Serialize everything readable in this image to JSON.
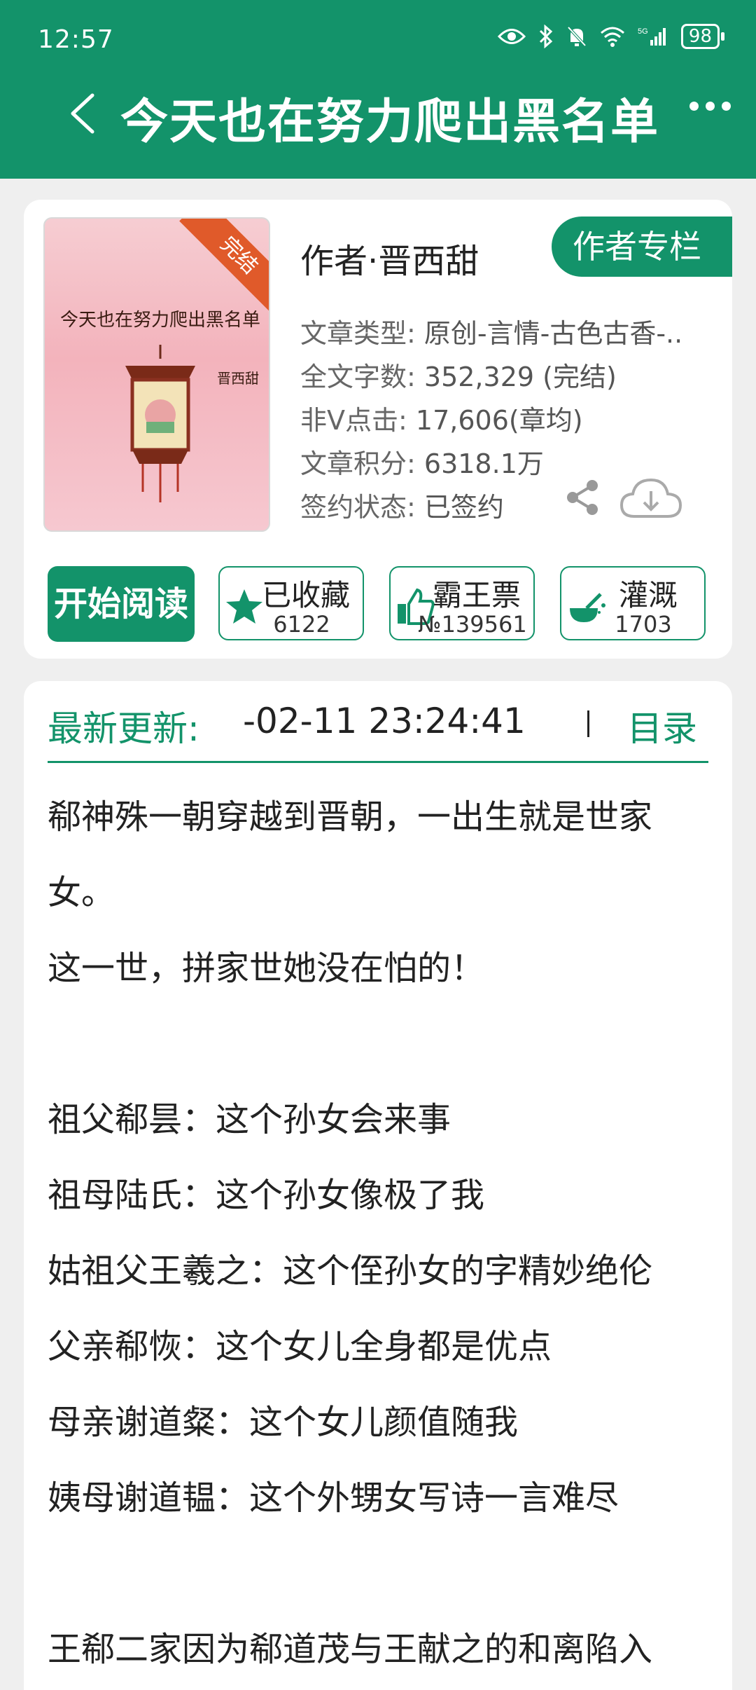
{
  "status_bar": {
    "time": "12:57",
    "battery": "98"
  },
  "header": {
    "title": "今天也在努力爬出黑名单"
  },
  "book": {
    "cover_title": "今天也在努力爬出黑名单",
    "cover_author": "晋西甜",
    "cover_badge": "完结",
    "author_line": "作者·晋西甜",
    "author_column_button": "作者专栏",
    "meta": [
      {
        "key": "文章类型:",
        "value": "原创-言情-古色古香-.."
      },
      {
        "key": "全文字数:",
        "value": "352,329 (完结)"
      },
      {
        "key": "非V点击:",
        "value": "17,606(章均)"
      },
      {
        "key": "文章积分:",
        "value": "6318.1万"
      },
      {
        "key": "签约状态:",
        "value": "已签约"
      }
    ]
  },
  "actions": {
    "read_button": "开始阅读",
    "favorite": {
      "label": "已收藏",
      "count": "6122"
    },
    "vote": {
      "label": "霸王票",
      "count": "№139561"
    },
    "water": {
      "label": "灌溉",
      "count": "1703"
    }
  },
  "update": {
    "label": "最新更新:",
    "time": "-02-11 23:24:41",
    "toc_label": "目录"
  },
  "summary": [
    "郗神殊一朝穿越到晋朝，一出生就是世家",
    "女。",
    "这一世，拼家世她没在怕的！",
    "",
    "祖父郗昙：这个孙女会来事",
    "祖母陆氏：这个孙女像极了我",
    "姑祖父王羲之：这个侄孙女的字精妙绝伦",
    "父亲郗恢：这个女儿全身都是优点",
    "母亲谢道粲：这个女儿颜值随我",
    "姨母谢道韫：这个外甥女写诗一言难尽",
    "",
    "王郗二家因为郗道茂与王献之的和离陷入"
  ],
  "colors": {
    "brand": "#13936a",
    "badge": "#e05a2a"
  }
}
